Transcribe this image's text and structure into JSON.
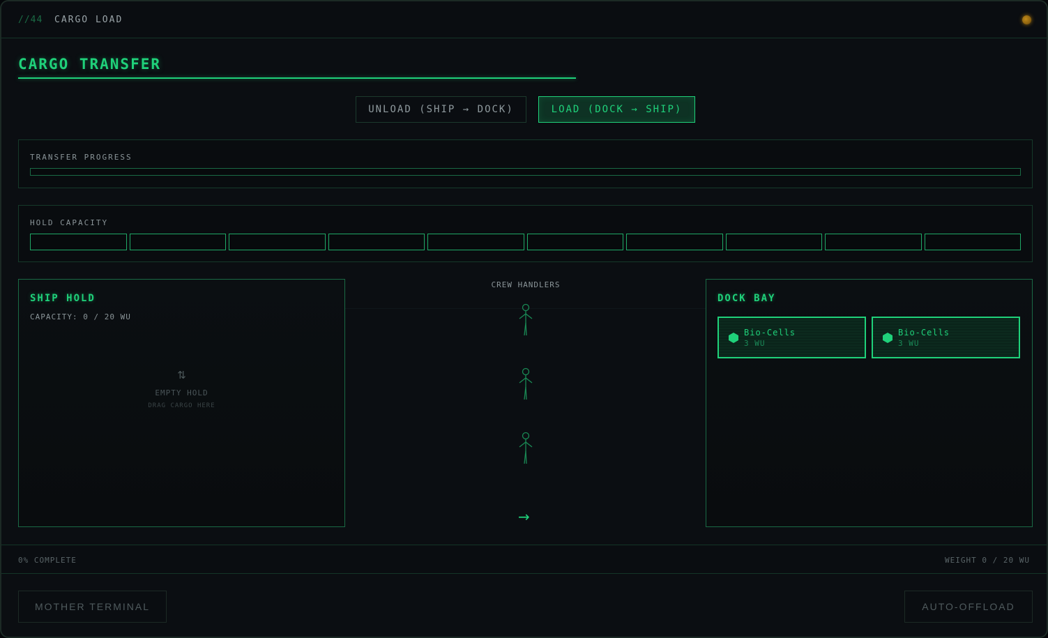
{
  "topbar": {
    "code": "//44",
    "title": "CARGO LOAD",
    "status_icon": "status-indicator-dot"
  },
  "page_title": "CARGO TRANSFER",
  "modes": {
    "unload_label": "UNLOAD (SHIP → DOCK)",
    "load_label": "LOAD (DOCK → SHIP)",
    "active": "load"
  },
  "progress": {
    "label": "TRANSFER PROGRESS",
    "value": 0
  },
  "capacity": {
    "label": "HOLD CAPACITY",
    "segments_total": 10,
    "segments_filled": 0
  },
  "ship_hold": {
    "title": "SHIP HOLD",
    "capacity_text": "CAPACITY: 0 / 20 WU",
    "empty_icon": "⇅",
    "empty_title": "EMPTY HOLD",
    "empty_subtitle": "DRAG CARGO HERE"
  },
  "crew": {
    "label": "CREW HANDLERS",
    "count": 3,
    "arrow": "→"
  },
  "dock_bay": {
    "title": "DOCK BAY",
    "items": [
      {
        "name": "Bio-Cells",
        "weight": "3 WU"
      },
      {
        "name": "Bio-Cells",
        "weight": "3 WU"
      }
    ]
  },
  "status": {
    "left": "0% COMPLETE",
    "right": "WEIGHT 0 / 20 WU"
  },
  "footer": {
    "mother_terminal": "MOTHER TERMINAL",
    "auto_offload": "AUTO-OFFLOAD"
  },
  "colors": {
    "accent": "#1fd17a",
    "background": "#0b0e12",
    "border": "#153a2a",
    "warning": "#c08a1a"
  }
}
